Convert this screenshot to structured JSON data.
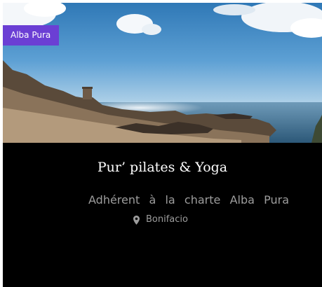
{
  "card": {
    "badge": "Alba Pura",
    "title": "Pur’ pilates & Yoga",
    "subtitle": "Adhérent à la charte Alba Pura",
    "location": {
      "icon": "map-pin-icon",
      "text": "Bonifacio"
    }
  },
  "colors": {
    "badge_bg": "#6b3fd4",
    "card_bg": "#000000",
    "title": "#ffffff",
    "muted_text": "#9d9d9d"
  }
}
